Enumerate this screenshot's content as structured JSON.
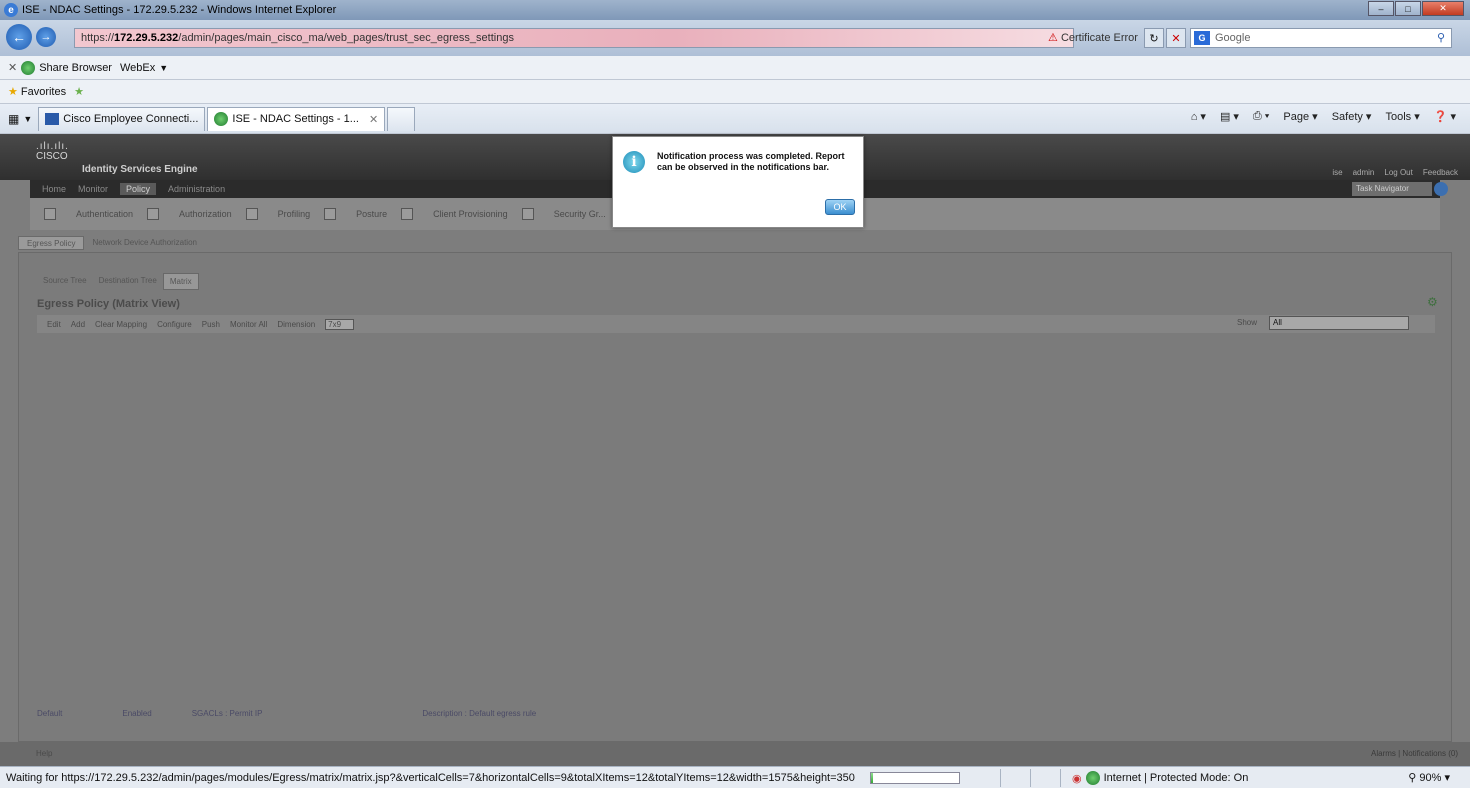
{
  "window": {
    "title": "ISE - NDAC Settings - 172.29.5.232 - Windows Internet Explorer"
  },
  "address_bar": {
    "url_prefix": "https://",
    "url_host": "172.29.5.232",
    "url_rest": "/admin/pages/main_cisco_ma/web_pages/trust_sec_egress_settings",
    "cert_error": "Certificate Error",
    "search_placeholder": "Google"
  },
  "links_bar": {
    "share_browser": "Share Browser",
    "webex": "WebEx"
  },
  "favorites_bar": {
    "favorites": "Favorites"
  },
  "tabs": [
    {
      "label": "Cisco Employee Connecti..."
    },
    {
      "label": "ISE - NDAC Settings - 1..."
    }
  ],
  "command_bar": {
    "page": "Page",
    "safety": "Safety",
    "tools": "Tools"
  },
  "ise": {
    "logo_text": "CISCO",
    "product": "Identity Services Engine",
    "user_links": [
      "ise",
      "admin",
      "Log Out",
      "Feedback"
    ],
    "menu": [
      "Home",
      "Monitor",
      "Policy",
      "Administration"
    ],
    "active_menu": "Policy",
    "task_navigator": "Task Navigator",
    "subnav": [
      "Authentication",
      "Authorization",
      "Profiling",
      "Posture",
      "Client Provisioning",
      "Security Gr..."
    ],
    "policy_tabs": [
      "Egress Policy",
      "Network Device Authorization"
    ],
    "tree_tabs": [
      "Source Tree",
      "Destination Tree",
      "Matrix"
    ],
    "panel_title": "Egress Policy (Matrix View)",
    "toolbar": [
      "Edit",
      "Add",
      "Clear Mapping",
      "Configure",
      "Push",
      "Monitor All",
      "Dimension"
    ],
    "dimension_value": "7x9",
    "show_label": "Show",
    "show_value": "All",
    "footer": {
      "default": "Default",
      "enabled": "Enabled",
      "sgacls": "SGACLs : Permit IP",
      "description": "Description : Default egress rule"
    },
    "help": "Help",
    "alarms": "Alarms",
    "notifications": "Notifications (0)"
  },
  "dialog": {
    "message": "Notification process was completed. Report can be observed in the notifications bar.",
    "ok": "OK"
  },
  "status_bar": {
    "message": "Waiting for https://172.29.5.232/admin/pages/modules/Egress/matrix/matrix.jsp?&verticalCells=7&horizontalCells=9&totalXItems=12&totalYItems=12&width=1575&height=350",
    "progress": 0.02,
    "zone": "Internet | Protected Mode: On",
    "zoom": "90%"
  }
}
